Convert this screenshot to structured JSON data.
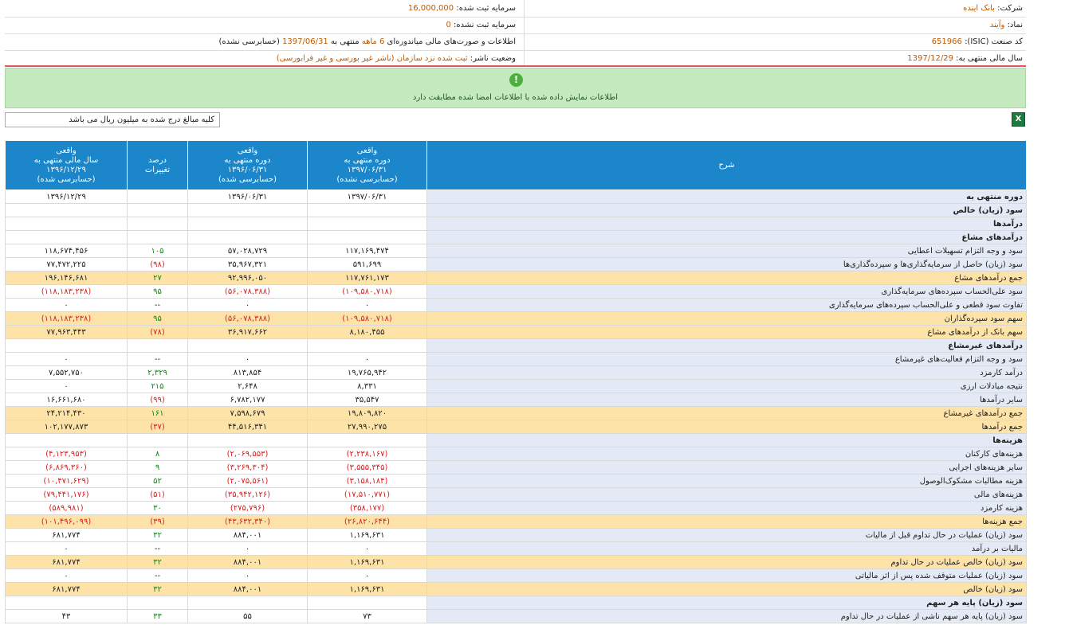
{
  "header": {
    "company_label": "شرکت:",
    "company_value": "بانک اینده",
    "registered_capital_label": "سرمایه ثبت شده:",
    "registered_capital_value": "16,000,000",
    "symbol_label": "نماد:",
    "symbol_value": "وآیند",
    "unregistered_capital_label": "سرمایه ثبت نشده:",
    "unregistered_capital_value": "0",
    "isic_label": "کد صنعت (ISIC):",
    "isic_value": "651966",
    "report_prefix": "اطلاعات و صورت‌های مالی میاندوره‌ای",
    "report_period": "6 ماهه",
    "report_mid": "منتهی به",
    "report_date": "1397/06/31",
    "report_suffix": "(حسابرسی نشده)",
    "fiscal_year_label": "سال مالی منتهی به:",
    "fiscal_year_value": "1397/12/29",
    "publisher_status_label": "وضعیت ناشر:",
    "publisher_status_value": "ثبت شده نزد سازمان (ناشر غیر بورسی و غیر فرابورسی)"
  },
  "notice": {
    "icon": "info-icon",
    "text": "اطلاعات نمایش داده شده با اطلاعات امضا شده مطابقت دارد"
  },
  "unit_note": "کلیه مبالغ درج شده به میلیون ریال می باشد",
  "excel_icon": "excel-export-icon",
  "table": {
    "headers": {
      "description": "شرح",
      "col1": [
        "واقعی",
        "دوره منتهی به",
        "۱۳۹۷/۰۶/۳۱",
        "(حسابرسی نشده)"
      ],
      "col2": [
        "واقعی",
        "دوره منتهی به",
        "۱۳۹۶/۰۶/۳۱",
        "(حسابرسی شده)"
      ],
      "col3": [
        "درصد",
        "تغییرات"
      ],
      "col4": [
        "واقعی",
        "سال مالی منتهی به",
        "۱۳۹۶/۱۲/۲۹",
        "(حسابرسی شده)"
      ]
    },
    "rows": [
      {
        "desc": "دوره منتهی به",
        "c1": "۱۳۹۷/۰۶/۳۱",
        "c2": "۱۳۹۶/۰۶/۳۱",
        "pct": "",
        "c4": "۱۳۹۶/۱۲/۲۹",
        "kind": "bold"
      },
      {
        "desc": "سود (زیان) خالص",
        "c1": "",
        "c2": "",
        "pct": "",
        "c4": "",
        "kind": "bold"
      },
      {
        "desc": "درآمدها",
        "c1": "",
        "c2": "",
        "pct": "",
        "c4": "",
        "kind": "bold"
      },
      {
        "desc": "درآمدهای مشاع",
        "c1": "",
        "c2": "",
        "pct": "",
        "c4": "",
        "kind": "bold"
      },
      {
        "desc": "سود و وجه التزام تسهیلات اعطایی",
        "c1": "۱۱۷,۱۶۹,۴۷۴",
        "c2": "۵۷,۰۲۸,۷۲۹",
        "pct": "۱۰۵",
        "c4": "۱۱۸,۶۷۴,۴۵۶",
        "kind": "normal"
      },
      {
        "desc": "سود (زیان) حاصل از سرمایه‌گذاری‌ها و سپرده‌گذاری‌ها",
        "c1": "۵۹۱,۶۹۹",
        "c2": "۳۵,۹۶۷,۳۲۱",
        "pct": "(۹۸)",
        "c4": "۷۷,۴۷۲,۲۲۵",
        "kind": "normal"
      },
      {
        "desc": "جمع درآمدهای مشاع",
        "c1": "۱۱۷,۷۶۱,۱۷۳",
        "c2": "۹۲,۹۹۶,۰۵۰",
        "pct": "۲۷",
        "c4": "۱۹۶,۱۴۶,۶۸۱",
        "kind": "total"
      },
      {
        "desc": "سود علی‌الحساب سپرده‌های سرمایه‌گذاری",
        "c1": "(۱۰۹,۵۸۰,۷۱۸)",
        "c2": "(۵۶,۰۷۸,۳۸۸)",
        "pct": "۹۵",
        "c4": "(۱۱۸,۱۸۳,۲۳۸)",
        "kind": "normal"
      },
      {
        "desc": "تفاوت سود قطعی و علی‌الحساب سپرده‌های سرمایه‌گذاری",
        "c1": "۰",
        "c2": "۰",
        "pct": "--",
        "c4": "۰",
        "kind": "normal"
      },
      {
        "desc": "سهم سود سپرده‌گذاران",
        "c1": "(۱۰۹,۵۸۰,۷۱۸)",
        "c2": "(۵۶,۰۷۸,۳۸۸)",
        "pct": "۹۵",
        "c4": "(۱۱۸,۱۸۳,۲۳۸)",
        "kind": "total"
      },
      {
        "desc": "سهم بانک از درآمدهای مشاع",
        "c1": "۸,۱۸۰,۴۵۵",
        "c2": "۳۶,۹۱۷,۶۶۲",
        "pct": "(۷۸)",
        "c4": "۷۷,۹۶۳,۴۴۳",
        "kind": "total"
      },
      {
        "desc": "درآمدهای غیرمشاع",
        "c1": "",
        "c2": "",
        "pct": "",
        "c4": "",
        "kind": "bold"
      },
      {
        "desc": "سود و وجه التزام فعالیت‌های غیرمشاع",
        "c1": "۰",
        "c2": "۰",
        "pct": "--",
        "c4": "۰",
        "kind": "normal"
      },
      {
        "desc": "درآمد کارمزد",
        "c1": "۱۹,۷۶۵,۹۴۲",
        "c2": "۸۱۳,۸۵۴",
        "pct": "۲,۳۲۹",
        "c4": "۷,۵۵۲,۷۵۰",
        "kind": "normal"
      },
      {
        "desc": "نتیجه مبادلات ارزی",
        "c1": "۸,۳۳۱",
        "c2": "۲,۶۴۸",
        "pct": "۲۱۵",
        "c4": "۰",
        "kind": "normal"
      },
      {
        "desc": "سایر درآمدها",
        "c1": "۳۵,۵۴۷",
        "c2": "۶,۷۸۲,۱۷۷",
        "pct": "(۹۹)",
        "c4": "۱۶,۶۶۱,۶۸۰",
        "kind": "normal"
      },
      {
        "desc": "جمع درآمدهای غیرمشاع",
        "c1": "۱۹,۸۰۹,۸۲۰",
        "c2": "۷,۵۹۸,۶۷۹",
        "pct": "۱۶۱",
        "c4": "۲۴,۲۱۴,۴۳۰",
        "kind": "total"
      },
      {
        "desc": "جمع درآمدها",
        "c1": "۲۷,۹۹۰,۲۷۵",
        "c2": "۴۴,۵۱۶,۳۴۱",
        "pct": "(۳۷)",
        "c4": "۱۰۲,۱۷۷,۸۷۳",
        "kind": "total"
      },
      {
        "desc": "هزینه‌ها",
        "c1": "",
        "c2": "",
        "pct": "",
        "c4": "",
        "kind": "bold"
      },
      {
        "desc": "هزینه‌های کارکنان",
        "c1": "(۲,۲۳۸,۱۶۷)",
        "c2": "(۲,۰۶۹,۵۵۳)",
        "pct": "۸",
        "c4": "(۴,۱۲۳,۹۵۳)",
        "kind": "normal"
      },
      {
        "desc": "سایر هزینه‌های اجرایی",
        "c1": "(۳,۵۵۵,۳۴۵)",
        "c2": "(۳,۲۶۹,۳۰۴)",
        "pct": "۹",
        "c4": "(۶,۸۶۹,۳۶۰)",
        "kind": "normal"
      },
      {
        "desc": "هزینه مطالبات مشکوک‌الوصول",
        "c1": "(۳,۱۵۸,۱۸۴)",
        "c2": "(۲,۰۷۵,۵۶۱)",
        "pct": "۵۲",
        "c4": "(۱۰,۴۷۱,۶۲۹)",
        "kind": "normal"
      },
      {
        "desc": "هزینه‌های مالی",
        "c1": "(۱۷,۵۱۰,۷۷۱)",
        "c2": "(۳۵,۹۴۲,۱۲۶)",
        "pct": "(۵۱)",
        "c4": "(۷۹,۴۴۱,۱۷۶)",
        "kind": "normal"
      },
      {
        "desc": "هزینه کارمزد",
        "c1": "(۳۵۸,۱۷۷)",
        "c2": "(۲۷۵,۷۹۶)",
        "pct": "۳۰",
        "c4": "(۵۸۹,۹۸۱)",
        "kind": "normal"
      },
      {
        "desc": "جمع هزینه‌ها",
        "c1": "(۲۶,۸۲۰,۶۴۴)",
        "c2": "(۴۳,۶۳۲,۳۴۰)",
        "pct": "(۳۹)",
        "c4": "(۱۰۱,۴۹۶,۰۹۹)",
        "kind": "total"
      },
      {
        "desc": "سود (زیان) عملیات در حال تداوم قبل از مالیات",
        "c1": "۱,۱۶۹,۶۳۱",
        "c2": "۸۸۴,۰۰۱",
        "pct": "۳۲",
        "c4": "۶۸۱,۷۷۴",
        "kind": "normal"
      },
      {
        "desc": "مالیات بر درآمد",
        "c1": "۰",
        "c2": "۰",
        "pct": "--",
        "c4": "۰",
        "kind": "normal"
      },
      {
        "desc": "سود (زیان) خالص عملیات در حال تداوم",
        "c1": "۱,۱۶۹,۶۳۱",
        "c2": "۸۸۴,۰۰۱",
        "pct": "۳۲",
        "c4": "۶۸۱,۷۷۴",
        "kind": "total"
      },
      {
        "desc": "سود (زیان) عملیات متوقف شده پس از اثر مالیاتی",
        "c1": "۰",
        "c2": "۰",
        "pct": "--",
        "c4": "۰",
        "kind": "normal"
      },
      {
        "desc": "سود (زیان) خالص",
        "c1": "۱,۱۶۹,۶۳۱",
        "c2": "۸۸۴,۰۰۱",
        "pct": "۳۲",
        "c4": "۶۸۱,۷۷۴",
        "kind": "total"
      },
      {
        "desc": "سود (زیان) پایه هر سهم",
        "c1": "",
        "c2": "",
        "pct": "",
        "c4": "",
        "kind": "bold"
      },
      {
        "desc": "سود (زیان) پایه هر سهم ناشی از عملیات در حال تداوم",
        "c1": "۷۳",
        "c2": "۵۵",
        "pct": "۳۳",
        "c4": "۴۳",
        "kind": "normal"
      }
    ]
  }
}
